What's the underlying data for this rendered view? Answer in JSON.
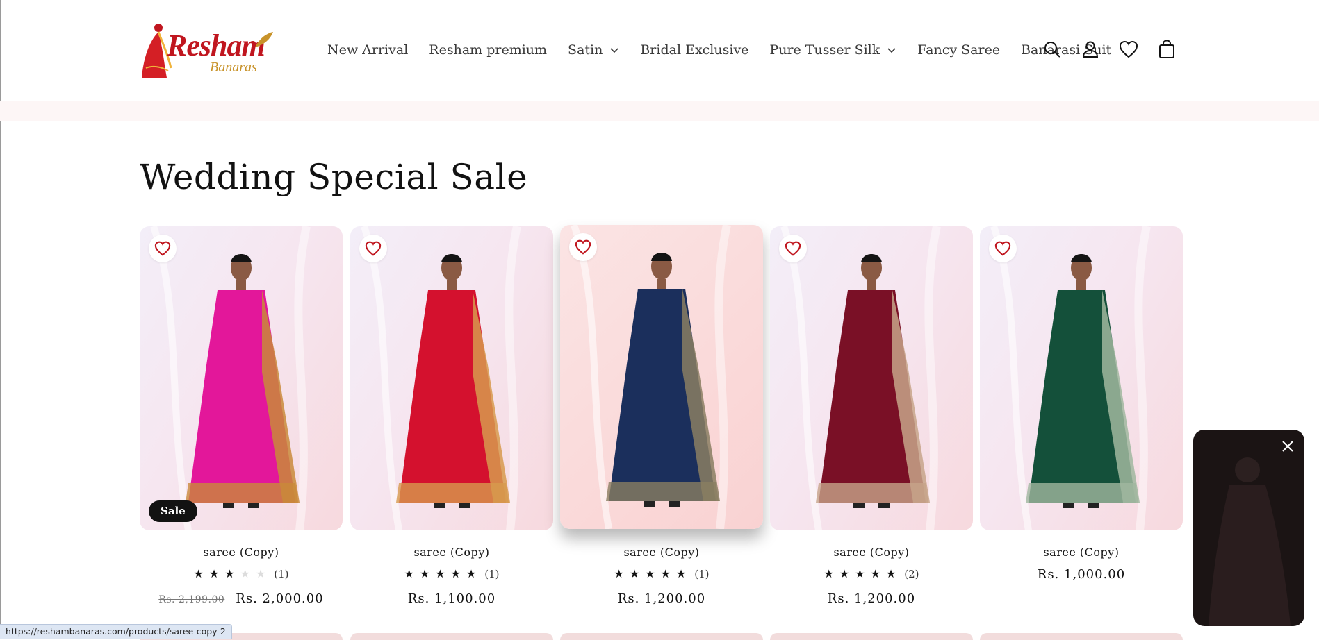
{
  "header": {
    "logo": {
      "main": "Resham",
      "sub": "Banaras"
    },
    "nav": [
      {
        "label": "New Arrival",
        "has_dropdown": false
      },
      {
        "label": "Resham premium",
        "has_dropdown": false
      },
      {
        "label": "Satin",
        "has_dropdown": true
      },
      {
        "label": "Bridal Exclusive",
        "has_dropdown": false
      },
      {
        "label": "Pure Tusser Silk",
        "has_dropdown": true
      },
      {
        "label": "Fancy Saree",
        "has_dropdown": false
      },
      {
        "label": "Banarasi Suit",
        "has_dropdown": false
      }
    ],
    "icons": [
      "search-icon",
      "account-icon",
      "wishlist-icon",
      "cart-icon"
    ]
  },
  "section": {
    "title": "Wedding Special Sale"
  },
  "products": [
    {
      "title": "saree (Copy)",
      "rating": 3,
      "reviews": "(1)",
      "compare_price": "Rs. 2,199.00",
      "price": "Rs. 2,000.00",
      "badge": "Sale",
      "saree_color": "#e3179a",
      "border_color": "#c98a3a"
    },
    {
      "title": "saree (Copy)",
      "rating": 5,
      "reviews": "(1)",
      "compare_price": "",
      "price": "Rs. 1,100.00",
      "badge": "",
      "saree_color": "#d4112e",
      "border_color": "#d79a4e"
    },
    {
      "title": "saree (Copy)",
      "rating": 5,
      "reviews": "(1)",
      "compare_price": "",
      "price": "Rs. 1,200.00",
      "badge": "",
      "saree_color": "#1b2f5c",
      "border_color": "#8a7e62"
    },
    {
      "title": "saree (Copy)",
      "rating": 5,
      "reviews": "(2)",
      "compare_price": "",
      "price": "Rs. 1,200.00",
      "badge": "",
      "saree_color": "#7a1026",
      "border_color": "#c7a48a"
    },
    {
      "title": "saree (Copy)",
      "rating": 0,
      "reviews": "",
      "compare_price": "",
      "price": "Rs. 1,000.00",
      "badge": "",
      "saree_color": "#14503a",
      "border_color": "#a0b79f"
    }
  ],
  "status_url": "https://reshambanaras.com/products/saree-copy-2",
  "colors": {
    "accent_red": "#c0161f",
    "gold": "#c8932a",
    "heart": "#c0161f",
    "announce_line": "#c44a4a"
  }
}
